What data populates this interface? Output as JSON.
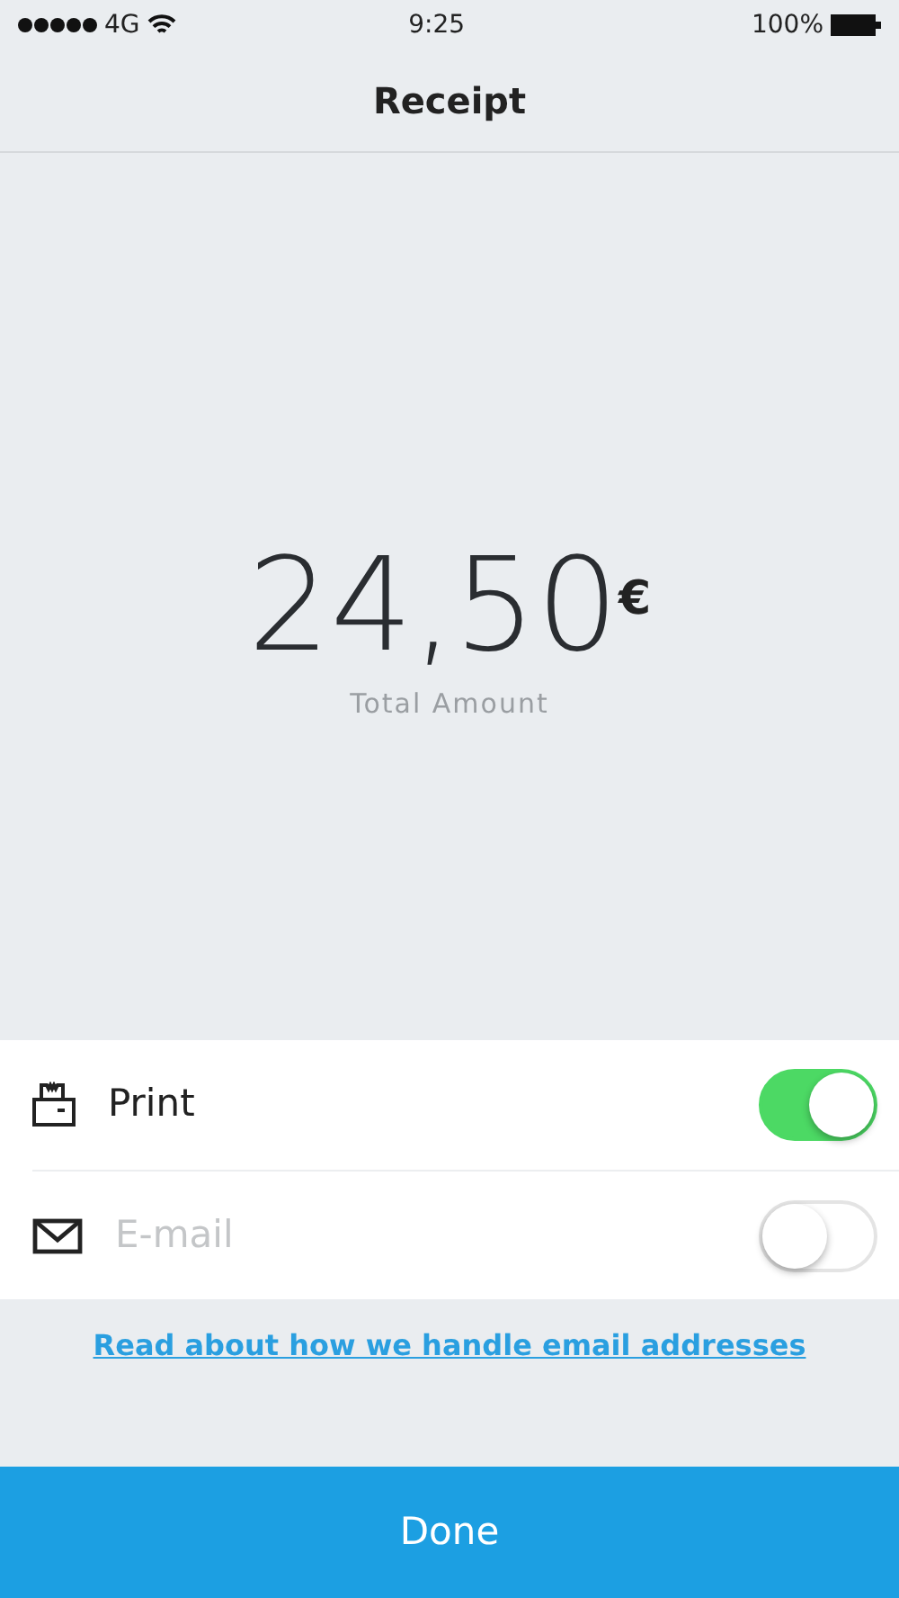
{
  "status_bar": {
    "carrier": "4G",
    "time": "9:25",
    "battery": "100%"
  },
  "nav": {
    "title": "Receipt"
  },
  "total": {
    "amount": "24,50",
    "currency": "€",
    "label": "Total Amount"
  },
  "options": [
    {
      "kind": "print",
      "label": "Print",
      "on": true
    },
    {
      "kind": "email",
      "label": "E-mail",
      "on": false
    }
  ],
  "link": "Read about how we handle email addresses",
  "done_button": "Done"
}
